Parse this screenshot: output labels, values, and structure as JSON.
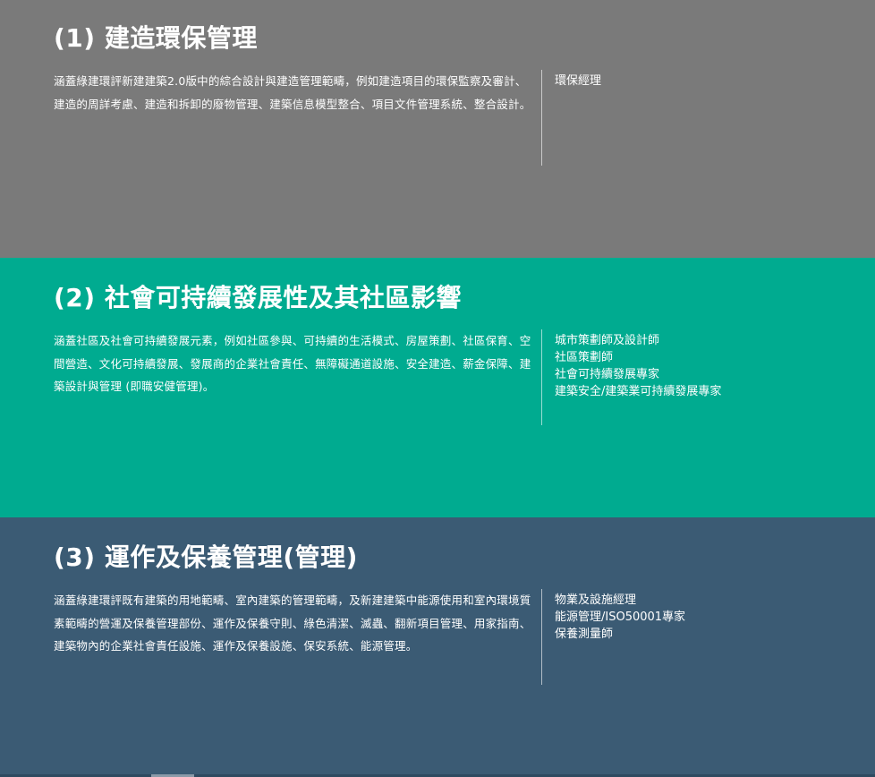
{
  "sections": [
    {
      "title": "(1) 建造環保管理",
      "description": "涵蓋綠建環評新建建築2.0版中的綜合設計與建造管理範疇，例如建造項目的環保監察及審計、建造的周詳考慮、建造和拆卸的廢物管理、建築信息模型整合、項目文件管理系統、整合設計。",
      "roles": [
        "環保經理"
      ]
    },
    {
      "title": "(2) 社會可持續發展性及其社區影響",
      "description": "涵蓋社區及社會可持續發展元素，例如社區參與、可持續的生活模式、房屋策劃、社區保育、空間營造、文化可持續發展、發展商的企業社會責任、無障礙通道設施、安全建造、薪金保障、建築設計與管理 (即職安健管理)。",
      "roles": [
        "城市策劃師及設計師",
        "社區策劃師",
        "社會可持續發展專家",
        "建築安全/建築業可持續發展專家"
      ]
    },
    {
      "title": "(3) 運作及保養管理(管理)",
      "description": "涵蓋綠建環評既有建築的用地範疇、室內建築的管理範疇，及新建建築中能源使用和室內環境質素範疇的營運及保養管理部份、運作及保養守則、綠色清潔、滅蟲、翻新項目管理、用家指南、建築物內的企業社會責任設施、運作及保養設施、保安系統、能源管理。",
      "roles": [
        "物業及設施經理",
        "能源管理/ISO50001專家",
        "保養測量師"
      ]
    }
  ],
  "colors": {
    "section_1_bg": "#7a7a7a",
    "section_2_bg": "#00ab90",
    "section_3_bg": "#3b5b74"
  }
}
